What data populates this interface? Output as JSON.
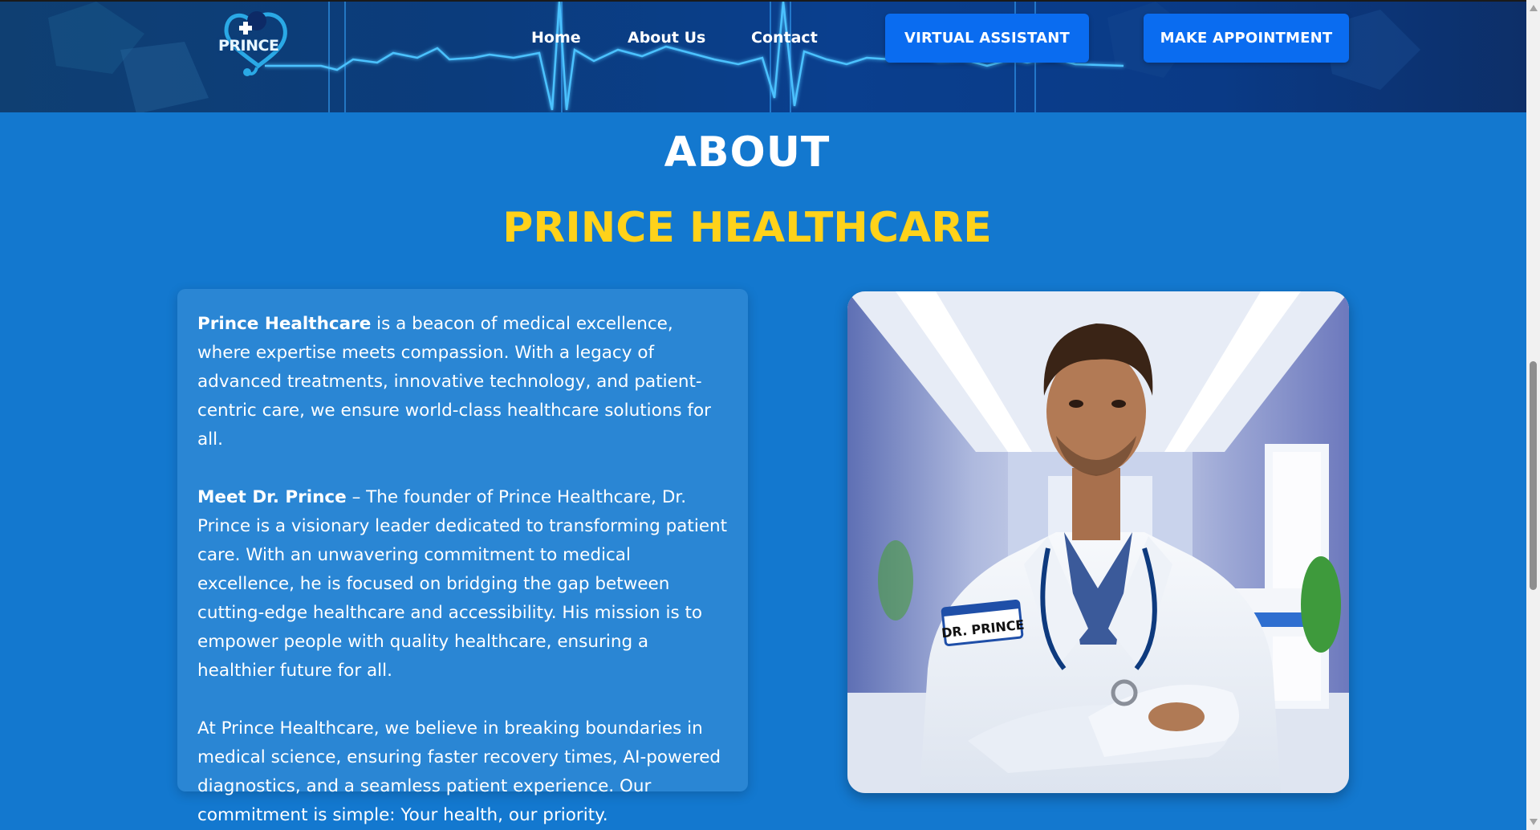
{
  "header": {
    "logo_text": "PRINCE",
    "nav": {
      "home": "Home",
      "about": "About Us",
      "contact": "Contact"
    },
    "virtual_assistant_label": "VIRTUAL ASSISTANT",
    "appointment_label": "MAKE APPOINTMENT"
  },
  "about": {
    "title": "ABOUT",
    "subtitle": "PRINCE HEALTHCARE",
    "p1_bold": "Prince Healthcare",
    "p1_text": " is a beacon of medical excellence, where expertise meets compassion. With a legacy of advanced treatments, innovative technology, and patient-centric care, we ensure world-class healthcare solutions for all.",
    "p2_bold": "Meet Dr. Prince",
    "p2_text": " – The founder of Prince Healthcare, Dr. Prince is a visionary leader dedicated to transforming patient care. With an unwavering commitment to medical excellence, he is focused on bridging the gap between cutting-edge healthcare and accessibility. His mission is to empower people with quality healthcare, ensuring a healthier future for all.",
    "p3_text": "At Prince Healthcare, we believe in breaking boundaries in medical science, ensuring faster recovery times, AI-powered diagnostics, and a seamless patient experience. Our commitment is simple: Your health, our priority.",
    "badge_text": "DR. PRINCE"
  },
  "colors": {
    "page_bg": "#1378cf",
    "card_bg": "#2a86d4",
    "accent_yellow": "#ffd21a",
    "button_blue": "#0a6cf0"
  }
}
